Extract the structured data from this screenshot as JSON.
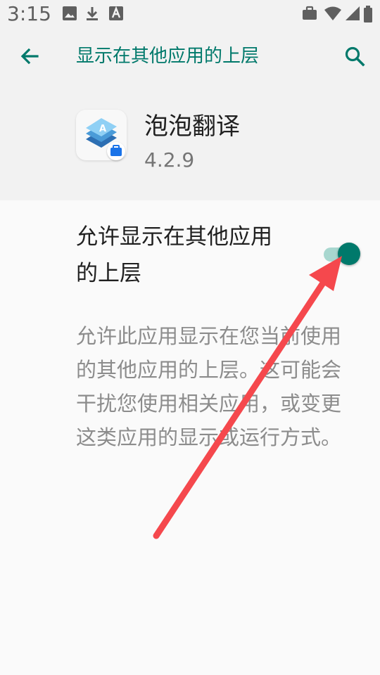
{
  "status_bar": {
    "time": "3:15",
    "left_icons": [
      "image-icon",
      "download-icon",
      "a-box-icon"
    ],
    "right_icons": [
      "briefcase-icon",
      "wifi-icon",
      "signal-icon",
      "battery-icon"
    ]
  },
  "toolbar": {
    "title": "显示在其他应用的上层",
    "back_icon": "arrow-left-icon",
    "search_icon": "search-icon"
  },
  "app": {
    "name": "泡泡翻译",
    "version": "4.2.9"
  },
  "setting": {
    "title": "允许显示在其他应用的上层",
    "enabled": true,
    "description": "允许此应用显示在您当前使用的其他应用的上层。这可能会干扰您使用相关应用，或变更这类应用的显示或运行方式。"
  },
  "colors": {
    "accent": "#00796b",
    "track_on": "#a8d7cf",
    "annotation_arrow": "#f5484d"
  }
}
